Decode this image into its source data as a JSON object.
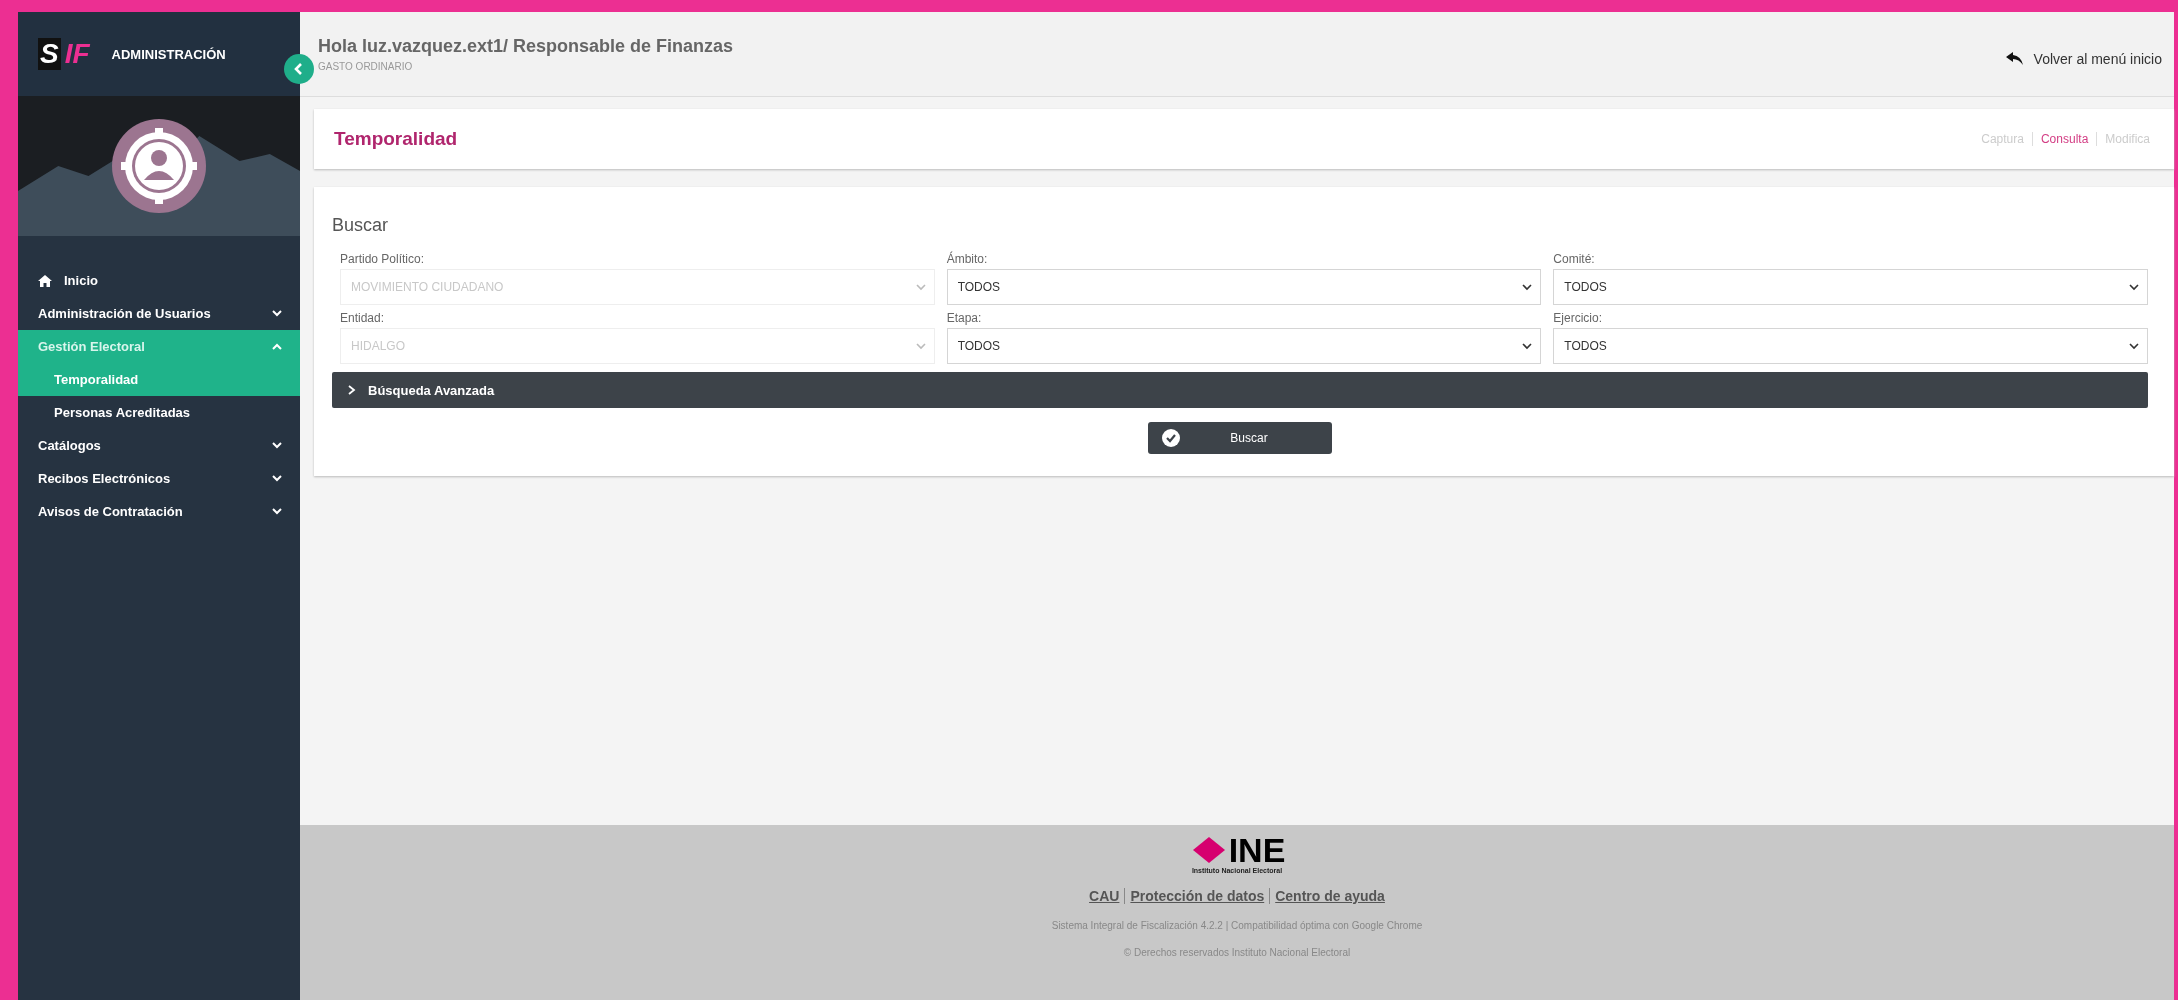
{
  "sidebar": {
    "logo": {
      "mark": "S",
      "mark_accent": "IF",
      "title": "ADMINISTRACIÓN"
    },
    "collapsed": false,
    "items": [
      {
        "label": "Inicio",
        "kind": "home"
      },
      {
        "label": "Administración de Usuarios",
        "kind": "group",
        "expanded": false
      },
      {
        "label": "Gestión Electoral",
        "kind": "group",
        "expanded": true,
        "children": [
          {
            "label": "Temporalidad",
            "selected": true
          },
          {
            "label": "Personas Acreditadas",
            "selected": false
          }
        ]
      },
      {
        "label": "Catálogos",
        "kind": "group",
        "expanded": false
      },
      {
        "label": "Recibos Electrónicos",
        "kind": "group",
        "expanded": false
      },
      {
        "label": "Avisos de Contratación",
        "kind": "group",
        "expanded": false
      }
    ]
  },
  "header": {
    "greeting": "Hola luz.vazquez.ext1/ Responsable de Finanzas",
    "subtitle": "GASTO ORDINARIO",
    "back_link": "Volver al menú inicio"
  },
  "page": {
    "title": "Temporalidad",
    "tabs": [
      {
        "label": "Captura",
        "selected": false
      },
      {
        "label": "Consulta",
        "selected": true
      },
      {
        "label": "Modifica",
        "selected": false
      }
    ]
  },
  "search": {
    "title": "Buscar",
    "fields": [
      {
        "label": "Partido Político:",
        "value": "MOVIMIENTO CIUDADANO",
        "disabled": true
      },
      {
        "label": "Ámbito:",
        "value": "TODOS",
        "disabled": false
      },
      {
        "label": "Comité:",
        "value": "TODOS",
        "disabled": false
      },
      {
        "label": "Entidad:",
        "value": "HIDALGO",
        "disabled": true
      },
      {
        "label": "Etapa:",
        "value": "TODOS",
        "disabled": false
      },
      {
        "label": "Ejercicio:",
        "value": "TODOS",
        "disabled": false
      }
    ],
    "advanced": {
      "label": "Búsqueda Avanzada",
      "expanded": false
    },
    "button": "Buscar"
  },
  "footer": {
    "logo": {
      "name": "INE",
      "caption": "Instituto Nacional Electoral"
    },
    "links": [
      "CAU",
      "Protección de datos",
      "Centro de ayuda"
    ],
    "version": "Sistema Integral de Fiscalización 4.2.2 | Compatibilidad óptima con Google Chrome",
    "copyright": "© Derechos reservados Instituto Nacional Electoral"
  }
}
